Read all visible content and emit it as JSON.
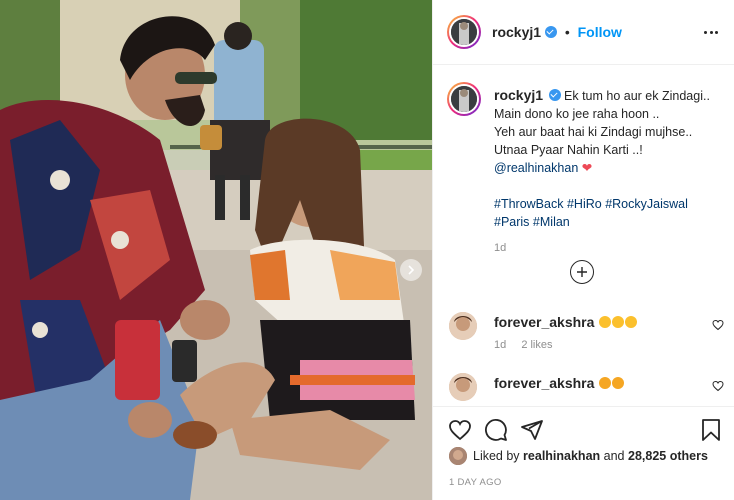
{
  "post": {
    "username": "rockyj1",
    "follow_label": "Follow",
    "separator": "•",
    "caption_lines": [
      "Ek tum ho aur ek Zindagi..",
      "Main dono ko jee raha hoon ..",
      "Yeh aur baat hai ki Zindagi mujhse..",
      "Utnaa Pyaar Nahin Karti ..!"
    ],
    "mention": "@realhinakhan",
    "hashtags_line1": [
      "#ThrowBack",
      "#HiRo",
      "#RockyJaiswal"
    ],
    "hashtags_line2": [
      "#Paris",
      "#Milan"
    ],
    "caption_time": "1d"
  },
  "comments": [
    {
      "username": "forever_akshra",
      "emoji_count": 3,
      "time": "1d",
      "likes": "2 likes"
    },
    {
      "username": "forever_akshra",
      "emoji_count": 2
    }
  ],
  "likes": {
    "liked_by_prefix": "Liked by",
    "liked_by_user": "realhinakhan",
    "and_label": "and",
    "others": "28,825 others"
  },
  "timestamp": "1 DAY AGO",
  "colors": {
    "accent": "#0095f6",
    "verified": "#3897f0",
    "heart": "#ed4956",
    "muted": "#8e8e8e"
  },
  "icons": [
    "more-options-icon",
    "verified-badge-icon",
    "heart-icon",
    "comment-icon",
    "share-icon",
    "bookmark-icon",
    "load-more-plus-icon",
    "next-arrow-icon"
  ]
}
